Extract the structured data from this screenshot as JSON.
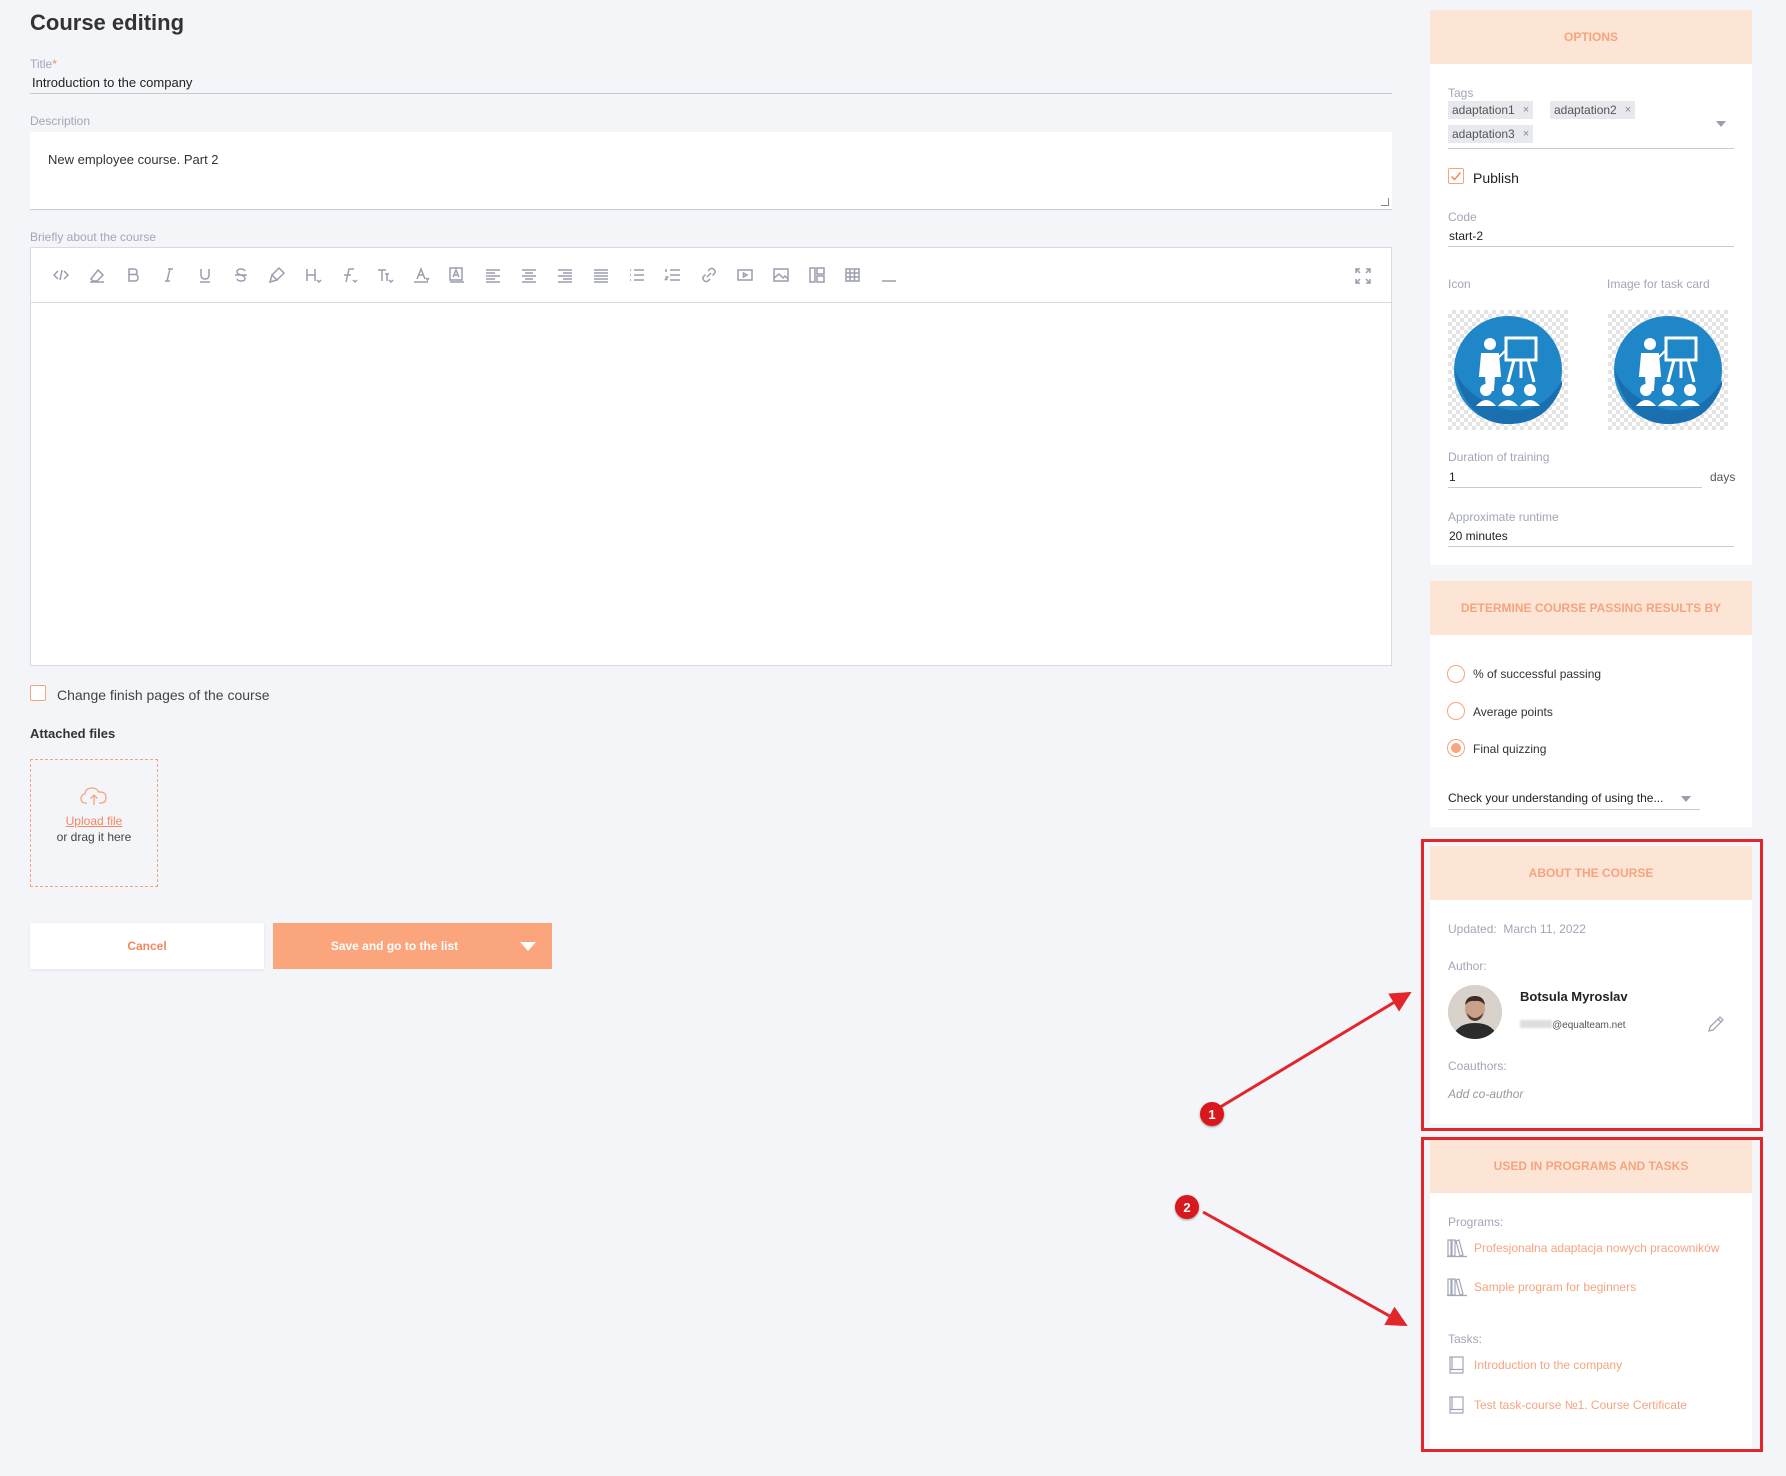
{
  "page": {
    "title": "Course editing"
  },
  "form": {
    "title_label": "Title",
    "title_required_mark": "*",
    "title_value": "Introduction to the company",
    "description_label": "Description",
    "description_value": "New employee course. Part 2",
    "brief_label": "Briefly about the course",
    "change_finish_label": "Change finish pages of the course",
    "attached_files_label": "Attached files",
    "upload_link": "Upload file",
    "upload_note": "or drag it here"
  },
  "actions": {
    "cancel_label": "Cancel",
    "save_label": "Save and go to the list"
  },
  "options": {
    "header": "OPTIONS",
    "tags_label": "Tags",
    "tags": [
      {
        "label": "adaptation1",
        "remove": "×"
      },
      {
        "label": "adaptation2",
        "remove": "×"
      },
      {
        "label": "adaptation3",
        "remove": "×"
      }
    ],
    "publish_label": "Publish",
    "publish_checked": true,
    "code_label": "Code",
    "code_value": "start-2",
    "icon_label": "Icon",
    "image_label": "Image for task card",
    "duration_label": "Duration of training",
    "duration_value": "1",
    "duration_unit": "days",
    "runtime_label": "Approximate runtime",
    "runtime_value": "20 minutes"
  },
  "results": {
    "header": "DETERMINE COURSE PASSING RESULTS BY",
    "options": [
      {
        "label": "% of successful passing",
        "selected": false
      },
      {
        "label": "Average points",
        "selected": false
      },
      {
        "label": "Final quizzing",
        "selected": true
      }
    ],
    "quiz_select_value": "Check your understanding of using the..."
  },
  "about": {
    "header": "ABOUT THE COURSE",
    "updated_label": "Updated:",
    "updated_value": "March 11, 2022",
    "author_label": "Author:",
    "author_name": "Botsula Myroslav",
    "author_email": "@equalteam.net",
    "coauthors_label": "Coauthors:",
    "add_coauthor": "Add co-author"
  },
  "usage": {
    "header": "USED IN PROGRAMS AND TASKS",
    "programs_label": "Programs:",
    "programs": [
      "Profesjonalna adaptacja nowych pracowników",
      "Sample program for beginners"
    ],
    "tasks_label": "Tasks:",
    "tasks": [
      "Introduction to the company",
      "Test task-course №1. Course Certificate"
    ]
  },
  "annotations": {
    "marker_1": "1",
    "marker_2": "2"
  },
  "colors": {
    "accent": "#f5875f",
    "accent_light": "#fde5d5",
    "highlight": "#e3262b"
  }
}
